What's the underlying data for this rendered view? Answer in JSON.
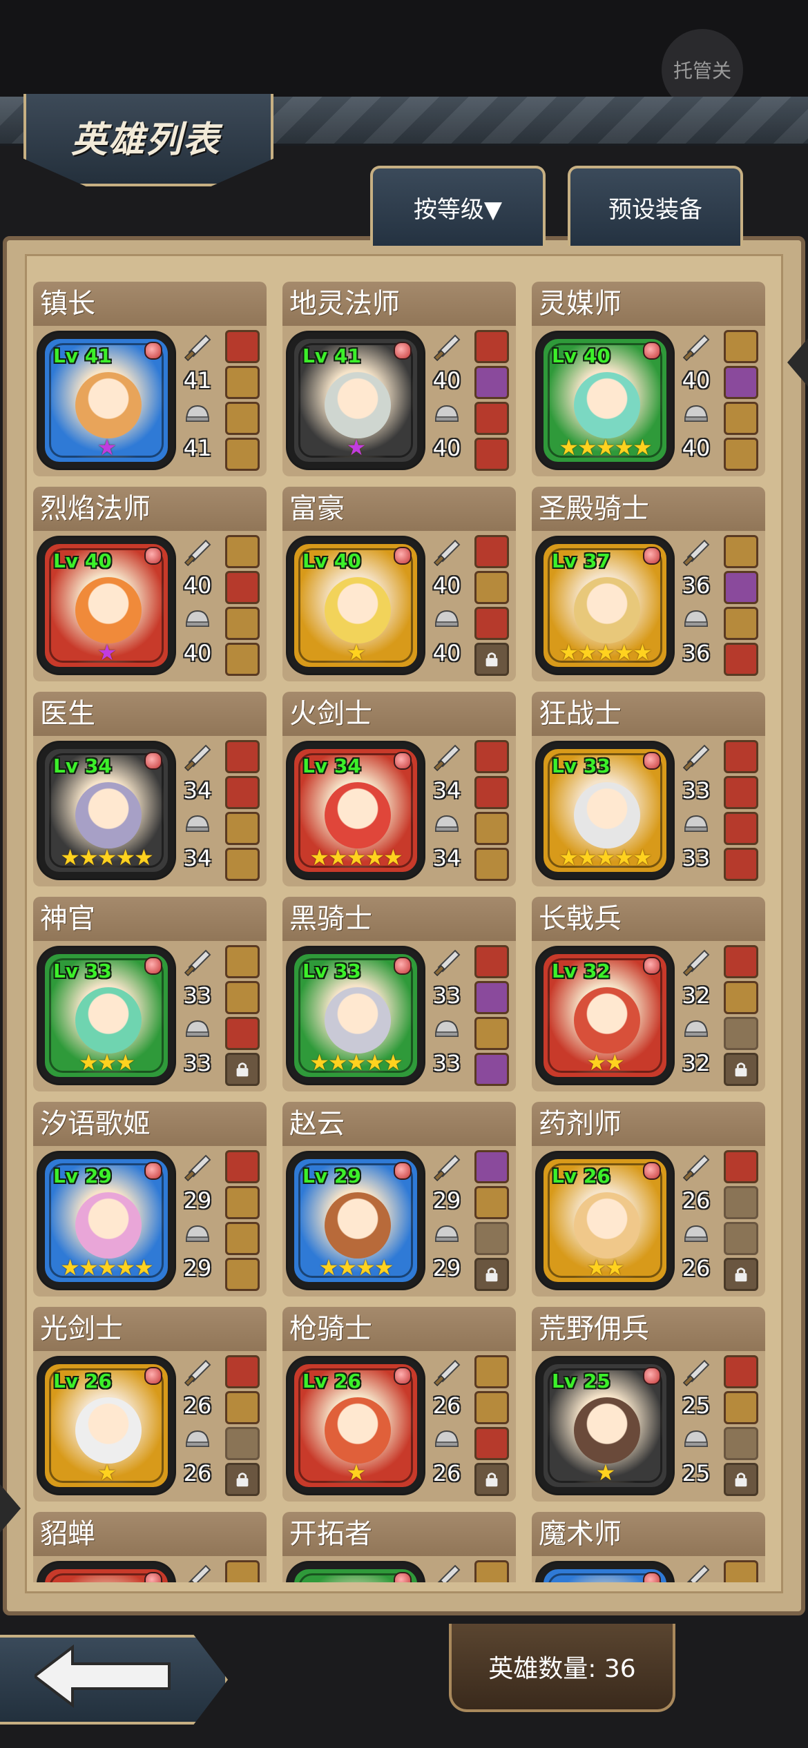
{
  "header": {
    "tg_button": "托管关",
    "title": "英雄列表",
    "sort_label": "按等级▼",
    "preset_label": "预设装备"
  },
  "footer": {
    "hero_count": "英雄数量: 36"
  },
  "heroes": [
    {
      "name": "镇长",
      "level": "Lv 41",
      "atk": "41",
      "def": "41",
      "stars": "★",
      "star_color": "purple",
      "frame": "blue",
      "face": "#e8a45a",
      "equip": [
        "red",
        "gold",
        "gold",
        "gold"
      ]
    },
    {
      "name": "地灵法师",
      "level": "Lv 41",
      "atk": "40",
      "def": "40",
      "stars": "★",
      "star_color": "purple",
      "frame": "dark",
      "face": "#cfd6d0",
      "equip": [
        "red",
        "purple",
        "red",
        "red"
      ]
    },
    {
      "name": "灵媒师",
      "level": "Lv 40",
      "atk": "40",
      "def": "40",
      "stars": "★★★★★",
      "star_color": "gold",
      "frame": "green",
      "face": "#7bd8c2",
      "equip": [
        "gold",
        "purple",
        "gold",
        "gold"
      ]
    },
    {
      "name": "烈焰法师",
      "level": "Lv 40",
      "atk": "40",
      "def": "40",
      "stars": "★",
      "star_color": "purple",
      "frame": "red",
      "face": "#f08a3a",
      "equip": [
        "gold",
        "red",
        "gold",
        "gold"
      ]
    },
    {
      "name": "富豪",
      "level": "Lv 40",
      "atk": "40",
      "def": "40",
      "stars": "★",
      "star_color": "gold",
      "frame": "gold",
      "face": "#f2d35a",
      "equip": [
        "red",
        "gold",
        "red",
        "lock"
      ]
    },
    {
      "name": "圣殿骑士",
      "level": "Lv 37",
      "atk": "36",
      "def": "36",
      "stars": "★★★★★",
      "star_color": "gold",
      "frame": "gold",
      "face": "#e8c87a",
      "equip": [
        "gold",
        "purple",
        "gold",
        "red"
      ]
    },
    {
      "name": "医生",
      "level": "Lv 34",
      "atk": "34",
      "def": "34",
      "stars": "★★★★★",
      "star_color": "gold",
      "frame": "dark",
      "face": "#a7a0c6",
      "equip": [
        "red",
        "red",
        "gold",
        "gold"
      ]
    },
    {
      "name": "火剑士",
      "level": "Lv 34",
      "atk": "34",
      "def": "34",
      "stars": "★★★★★",
      "star_color": "gold",
      "frame": "red",
      "face": "#e0463a",
      "equip": [
        "red",
        "red",
        "gold",
        "gold"
      ]
    },
    {
      "name": "狂战士",
      "level": "Lv 33",
      "atk": "33",
      "def": "33",
      "stars": "★★★★★",
      "star_color": "gold",
      "frame": "gold",
      "face": "#e6e6e6",
      "equip": [
        "red",
        "red",
        "red",
        "red"
      ]
    },
    {
      "name": "神官",
      "level": "Lv 33",
      "atk": "33",
      "def": "33",
      "stars": "★★★",
      "star_color": "gold",
      "frame": "green",
      "face": "#6fd4b0",
      "equip": [
        "gold",
        "gold",
        "red",
        "lock"
      ]
    },
    {
      "name": "黑骑士",
      "level": "Lv 33",
      "atk": "33",
      "def": "33",
      "stars": "★★★★★",
      "star_color": "gold",
      "frame": "green",
      "face": "#c9c9d6",
      "equip": [
        "red",
        "purple",
        "gold",
        "purple"
      ]
    },
    {
      "name": "长戟兵",
      "level": "Lv 32",
      "atk": "32",
      "def": "32",
      "stars": "★★",
      "star_color": "gold",
      "frame": "red",
      "face": "#d8503a",
      "equip": [
        "red",
        "gold",
        "empty",
        "lock"
      ]
    },
    {
      "name": "汐语歌姬",
      "level": "Lv 29",
      "atk": "29",
      "def": "29",
      "stars": "★★★★★",
      "star_color": "gold",
      "frame": "blue",
      "face": "#e9a6d8",
      "equip": [
        "red",
        "gold",
        "gold",
        "gold"
      ]
    },
    {
      "name": "赵云",
      "level": "Lv 29",
      "atk": "29",
      "def": "29",
      "stars": "★★★★",
      "star_color": "gold",
      "frame": "blue",
      "face": "#b86a3a",
      "equip": [
        "purple",
        "gold",
        "empty",
        "lock"
      ]
    },
    {
      "name": "药剂师",
      "level": "Lv 26",
      "atk": "26",
      "def": "26",
      "stars": "★★",
      "star_color": "gold",
      "frame": "gold",
      "face": "#f0c88a",
      "equip": [
        "red",
        "empty",
        "empty",
        "lock"
      ]
    },
    {
      "name": "光剑士",
      "level": "Lv 26",
      "atk": "26",
      "def": "26",
      "stars": "★",
      "star_color": "gold",
      "frame": "gold",
      "face": "#eeeeee",
      "equip": [
        "red",
        "gold",
        "empty",
        "lock"
      ]
    },
    {
      "name": "枪骑士",
      "level": "Lv 26",
      "atk": "26",
      "def": "26",
      "stars": "★",
      "star_color": "gold",
      "frame": "red",
      "face": "#e0603a",
      "equip": [
        "gold",
        "gold",
        "red",
        "lock"
      ]
    },
    {
      "name": "荒野佣兵",
      "level": "Lv 25",
      "atk": "25",
      "def": "25",
      "stars": "★",
      "star_color": "gold",
      "frame": "dark",
      "face": "#6a4a3a",
      "equip": [
        "red",
        "gold",
        "empty",
        "lock"
      ]
    },
    {
      "name": "貂蝉",
      "level": "",
      "atk": "",
      "def": "",
      "stars": "",
      "star_color": "gold",
      "frame": "red",
      "face": "#e08a8a",
      "equip": [
        "gold",
        "gold",
        "gold",
        "gold"
      ]
    },
    {
      "name": "开拓者",
      "level": "",
      "atk": "",
      "def": "",
      "stars": "",
      "star_color": "gold",
      "frame": "green",
      "face": "#8ac28a",
      "equip": [
        "gold",
        "gold",
        "gold",
        "gold"
      ]
    },
    {
      "name": "魔术师",
      "level": "",
      "atk": "",
      "def": "",
      "stars": "",
      "star_color": "gold",
      "frame": "blue",
      "face": "#8a9ad8",
      "equip": [
        "gold",
        "gold",
        "gold",
        "gold"
      ]
    }
  ]
}
